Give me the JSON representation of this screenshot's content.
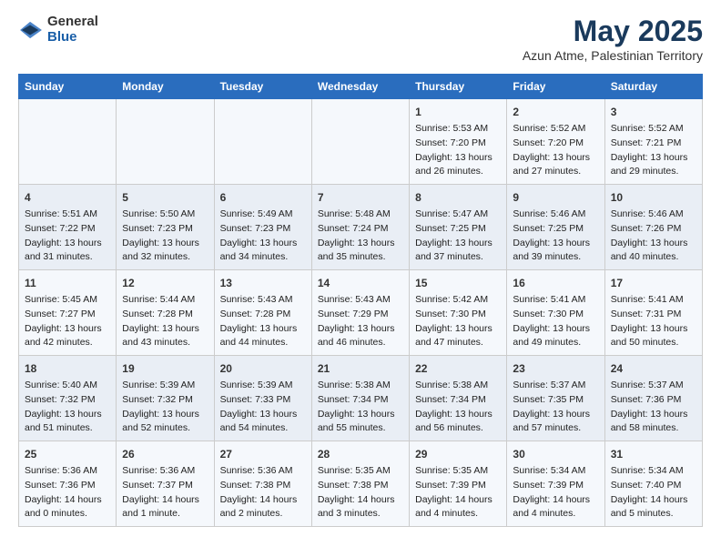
{
  "header": {
    "logo": {
      "general": "General",
      "blue": "Blue"
    },
    "title": "May 2025",
    "subtitle": "Azun Atme, Palestinian Territory"
  },
  "columns": [
    "Sunday",
    "Monday",
    "Tuesday",
    "Wednesday",
    "Thursday",
    "Friday",
    "Saturday"
  ],
  "weeks": [
    {
      "days": [
        {
          "num": "",
          "content": ""
        },
        {
          "num": "",
          "content": ""
        },
        {
          "num": "",
          "content": ""
        },
        {
          "num": "",
          "content": ""
        },
        {
          "num": "1",
          "content": "Sunrise: 5:53 AM\nSunset: 7:20 PM\nDaylight: 13 hours and 26 minutes."
        },
        {
          "num": "2",
          "content": "Sunrise: 5:52 AM\nSunset: 7:20 PM\nDaylight: 13 hours and 27 minutes."
        },
        {
          "num": "3",
          "content": "Sunrise: 5:52 AM\nSunset: 7:21 PM\nDaylight: 13 hours and 29 minutes."
        }
      ]
    },
    {
      "days": [
        {
          "num": "4",
          "content": "Sunrise: 5:51 AM\nSunset: 7:22 PM\nDaylight: 13 hours and 31 minutes."
        },
        {
          "num": "5",
          "content": "Sunrise: 5:50 AM\nSunset: 7:23 PM\nDaylight: 13 hours and 32 minutes."
        },
        {
          "num": "6",
          "content": "Sunrise: 5:49 AM\nSunset: 7:23 PM\nDaylight: 13 hours and 34 minutes."
        },
        {
          "num": "7",
          "content": "Sunrise: 5:48 AM\nSunset: 7:24 PM\nDaylight: 13 hours and 35 minutes."
        },
        {
          "num": "8",
          "content": "Sunrise: 5:47 AM\nSunset: 7:25 PM\nDaylight: 13 hours and 37 minutes."
        },
        {
          "num": "9",
          "content": "Sunrise: 5:46 AM\nSunset: 7:25 PM\nDaylight: 13 hours and 39 minutes."
        },
        {
          "num": "10",
          "content": "Sunrise: 5:46 AM\nSunset: 7:26 PM\nDaylight: 13 hours and 40 minutes."
        }
      ]
    },
    {
      "days": [
        {
          "num": "11",
          "content": "Sunrise: 5:45 AM\nSunset: 7:27 PM\nDaylight: 13 hours and 42 minutes."
        },
        {
          "num": "12",
          "content": "Sunrise: 5:44 AM\nSunset: 7:28 PM\nDaylight: 13 hours and 43 minutes."
        },
        {
          "num": "13",
          "content": "Sunrise: 5:43 AM\nSunset: 7:28 PM\nDaylight: 13 hours and 44 minutes."
        },
        {
          "num": "14",
          "content": "Sunrise: 5:43 AM\nSunset: 7:29 PM\nDaylight: 13 hours and 46 minutes."
        },
        {
          "num": "15",
          "content": "Sunrise: 5:42 AM\nSunset: 7:30 PM\nDaylight: 13 hours and 47 minutes."
        },
        {
          "num": "16",
          "content": "Sunrise: 5:41 AM\nSunset: 7:30 PM\nDaylight: 13 hours and 49 minutes."
        },
        {
          "num": "17",
          "content": "Sunrise: 5:41 AM\nSunset: 7:31 PM\nDaylight: 13 hours and 50 minutes."
        }
      ]
    },
    {
      "days": [
        {
          "num": "18",
          "content": "Sunrise: 5:40 AM\nSunset: 7:32 PM\nDaylight: 13 hours and 51 minutes."
        },
        {
          "num": "19",
          "content": "Sunrise: 5:39 AM\nSunset: 7:32 PM\nDaylight: 13 hours and 52 minutes."
        },
        {
          "num": "20",
          "content": "Sunrise: 5:39 AM\nSunset: 7:33 PM\nDaylight: 13 hours and 54 minutes."
        },
        {
          "num": "21",
          "content": "Sunrise: 5:38 AM\nSunset: 7:34 PM\nDaylight: 13 hours and 55 minutes."
        },
        {
          "num": "22",
          "content": "Sunrise: 5:38 AM\nSunset: 7:34 PM\nDaylight: 13 hours and 56 minutes."
        },
        {
          "num": "23",
          "content": "Sunrise: 5:37 AM\nSunset: 7:35 PM\nDaylight: 13 hours and 57 minutes."
        },
        {
          "num": "24",
          "content": "Sunrise: 5:37 AM\nSunset: 7:36 PM\nDaylight: 13 hours and 58 minutes."
        }
      ]
    },
    {
      "days": [
        {
          "num": "25",
          "content": "Sunrise: 5:36 AM\nSunset: 7:36 PM\nDaylight: 14 hours and 0 minutes."
        },
        {
          "num": "26",
          "content": "Sunrise: 5:36 AM\nSunset: 7:37 PM\nDaylight: 14 hours and 1 minute."
        },
        {
          "num": "27",
          "content": "Sunrise: 5:36 AM\nSunset: 7:38 PM\nDaylight: 14 hours and 2 minutes."
        },
        {
          "num": "28",
          "content": "Sunrise: 5:35 AM\nSunset: 7:38 PM\nDaylight: 14 hours and 3 minutes."
        },
        {
          "num": "29",
          "content": "Sunrise: 5:35 AM\nSunset: 7:39 PM\nDaylight: 14 hours and 4 minutes."
        },
        {
          "num": "30",
          "content": "Sunrise: 5:34 AM\nSunset: 7:39 PM\nDaylight: 14 hours and 4 minutes."
        },
        {
          "num": "31",
          "content": "Sunrise: 5:34 AM\nSunset: 7:40 PM\nDaylight: 14 hours and 5 minutes."
        }
      ]
    }
  ]
}
